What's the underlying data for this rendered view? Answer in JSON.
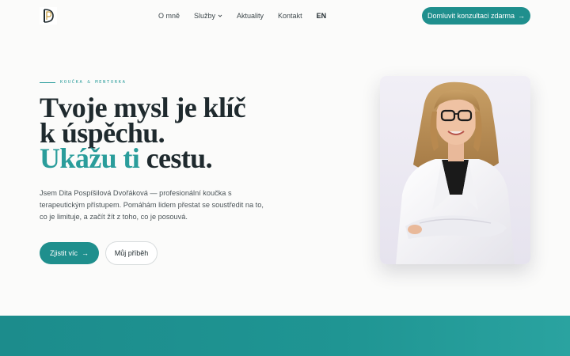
{
  "header": {
    "logo_icon": "dp-monogram-logo",
    "nav": [
      {
        "label": "O mně"
      },
      {
        "label": "Služby",
        "has_dropdown": true
      },
      {
        "label": "Aktuality"
      },
      {
        "label": "Kontakt"
      },
      {
        "label": "EN"
      }
    ],
    "cta_label": "Domluvit konzultaci zdarma",
    "cta_arrow": "→"
  },
  "hero": {
    "eyebrow": "KOUČKA & MENTORKA",
    "headline_line1": "Tvoje mysl je klíč",
    "headline_line2": "k úspěchu.",
    "headline_accent": "Ukážu ti",
    "headline_rest": " cestu.",
    "intro": "Jsem Dita Pospíšilová Dvořáková — profesionální koučka s terapeutickým přístupem. Pomáhám lidem přestat se soustředit na to, co je limituje, a začít žít z toho, co je posouvá.",
    "primary_button": "Zjistit víc",
    "primary_arrow": "→",
    "secondary_button": "Můj příběh"
  },
  "colors": {
    "accent": "#1f8f8d",
    "accent_text": "#2a9d9b",
    "text_dark": "#1f2a2e"
  }
}
